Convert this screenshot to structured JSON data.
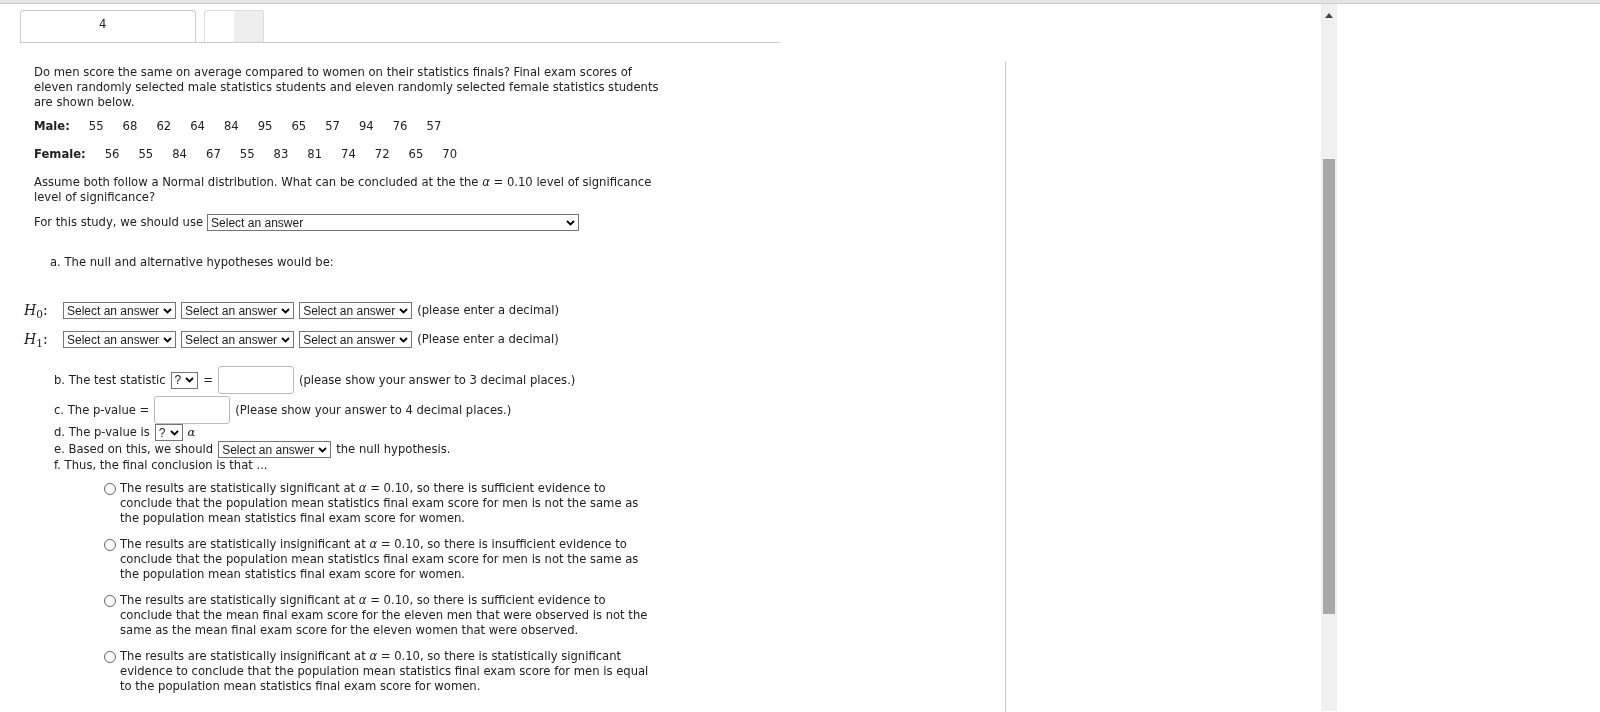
{
  "question_number": "4",
  "intro": "Do men score the same on average compared to women on their statistics finals? Final exam scores of eleven randomly selected male statistics students and eleven randomly selected female statistics students are shown below.",
  "samples": [
    {
      "label": "Male:",
      "values": [
        "55",
        "68",
        "62",
        "64",
        "84",
        "95",
        "65",
        "57",
        "94",
        "76",
        "57"
      ]
    },
    {
      "label": "Female:",
      "values": [
        "56",
        "55",
        "84",
        "67",
        "55",
        "83",
        "81",
        "74",
        "72",
        "65",
        "70"
      ]
    }
  ],
  "assumption": "Assume both follow a Normal distribution.  What can be concluded at the the *α* = 0.10 level of significance level of significance?",
  "study": {
    "label": "For this study, we should use",
    "select": "Select an answer"
  },
  "part_a": "a. The null and alternative hypotheses would be:",
  "hypotheses": [
    {
      "label": "*H*$_{0}$:",
      "selects": [
        "Select an answer",
        "Select an answer",
        "Select an answer"
      ],
      "note": "(please enter a decimal)"
    },
    {
      "label": "*H*$_{1}$:",
      "selects": [
        "Select an answer",
        "Select an answer",
        "Select an answer"
      ],
      "note": "(Please enter a decimal)"
    }
  ],
  "part_b": {
    "label": "b. The test statistic",
    "select": "?",
    "equals": "=",
    "note": "(please show your answer to 3 decimal places.)"
  },
  "part_c": {
    "label": "c. The p-value =",
    "note": "(Please show your answer to 4 decimal places.)"
  },
  "part_d": {
    "label": "d. The p-value is",
    "select": "?",
    "after": "*α*"
  },
  "part_e": {
    "label": "e. Based on this, we should",
    "select": "Select an answer",
    "after": "the null hypothesis."
  },
  "part_f": "f. Thus, the final conclusion is that ...",
  "options": [
    {
      "text": "The results are statistically significant at *α* = 0.10, so there is sufficient evidence to conclude that the population mean statistics final exam score for men is not the same as the population mean statistics final exam score for women.",
      "selected": false
    },
    {
      "text": "The results are statistically insignificant at *α* = 0.10, so there is insufficient evidence to conclude that the population mean statistics final exam score for men is not the same as the population mean statistics final exam score for women.",
      "selected": false
    },
    {
      "text": "The results are statistically significant at *α* = 0.10, so there is sufficient evidence to conclude that the mean final exam score for the eleven men that were observed is not the same as the mean final exam score for the eleven women that were observed.",
      "selected": false
    },
    {
      "text": "The results are statistically insignificant at *α* = 0.10, so there is statistically significant evidence to conclude that the population mean statistics final exam score for men is equal to the population mean statistics final exam score for women.",
      "selected": false
    }
  ]
}
